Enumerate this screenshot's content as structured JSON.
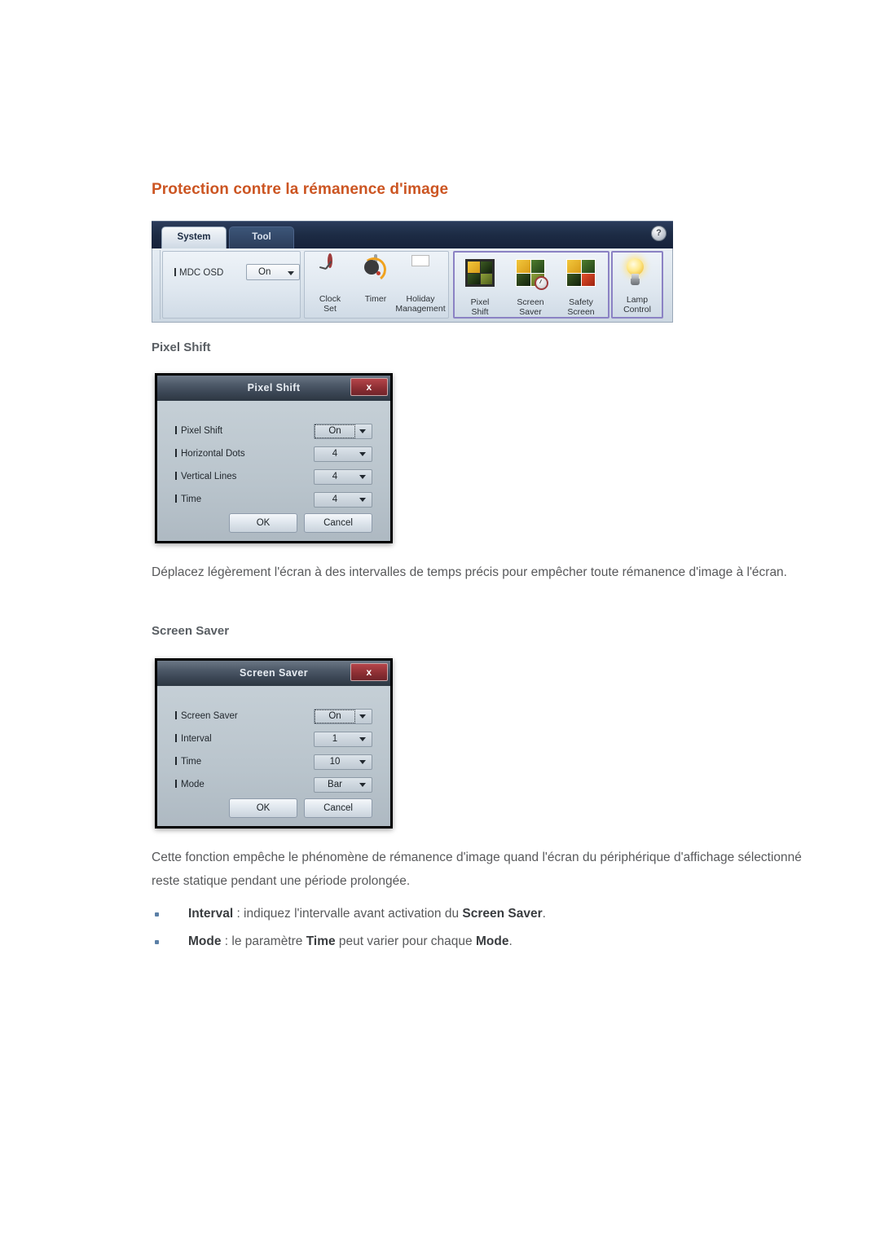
{
  "page": {
    "title": "Protection contre la rémanence d'image",
    "title_color": "#cc5522"
  },
  "ribbon": {
    "tabs": [
      {
        "label": "System",
        "active": true
      },
      {
        "label": "Tool",
        "active": false
      }
    ],
    "help_icon": "?",
    "osd": {
      "label": "MDC OSD",
      "value": "On"
    },
    "groups": [
      {
        "name": "time",
        "items": [
          {
            "line1": "Clock",
            "line2": "Set",
            "icon": "clock-icon"
          },
          {
            "line1": "Timer",
            "line2": "",
            "icon": "timer-icon"
          },
          {
            "line1": "Holiday",
            "line2": "Management",
            "icon": "calendar-icon"
          }
        ]
      },
      {
        "name": "protection",
        "highlighted": true,
        "items": [
          {
            "line1": "Pixel",
            "line2": "Shift",
            "icon": "pixel-shift-icon"
          },
          {
            "line1": "Screen",
            "line2": "Saver",
            "icon": "screen-saver-icon"
          },
          {
            "line1": "Safety",
            "line2": "Screen",
            "icon": "safety-screen-icon"
          }
        ]
      },
      {
        "name": "lamp",
        "highlighted": true,
        "items": [
          {
            "line1": "Lamp",
            "line2": "Control",
            "icon": "lamp-icon"
          }
        ]
      }
    ]
  },
  "sections": [
    {
      "heading": "Pixel Shift",
      "dialog": {
        "title": "Pixel Shift",
        "close_label": "x",
        "rows": [
          {
            "label": "Pixel Shift",
            "value": "On",
            "focused": true
          },
          {
            "label": "Horizontal Dots",
            "value": "4",
            "focused": false
          },
          {
            "label": "Vertical Lines",
            "value": "4",
            "focused": false
          },
          {
            "label": "Time",
            "value": "4",
            "focused": false
          }
        ],
        "ok_label": "OK",
        "cancel_label": "Cancel"
      },
      "paragraph": "Déplacez légèrement l'écran à des intervalles de temps précis pour empêcher toute rémanence d'image à l'écran."
    },
    {
      "heading": "Screen Saver",
      "dialog": {
        "title": "Screen Saver",
        "close_label": "x",
        "rows": [
          {
            "label": "Screen Saver",
            "value": "On",
            "focused": true
          },
          {
            "label": "Interval",
            "value": "1",
            "focused": false
          },
          {
            "label": "Time",
            "value": "10",
            "focused": false
          },
          {
            "label": "Mode",
            "value": "Bar",
            "focused": false
          }
        ],
        "ok_label": "OK",
        "cancel_label": "Cancel"
      },
      "paragraph": "Cette fonction empêche le phénomène de rémanence d'image quand l'écran du périphérique d'affichage sélectionné reste statique pendant une période prolongée."
    }
  ],
  "bullets": [
    {
      "parts": [
        {
          "text": "Interval",
          "bold": true
        },
        {
          "text": " : indiquez l'intervalle avant activation du ",
          "bold": false
        },
        {
          "text": "Screen Saver",
          "bold": true
        },
        {
          "text": ".",
          "bold": false
        }
      ]
    },
    {
      "parts": [
        {
          "text": "Mode",
          "bold": true
        },
        {
          "text": " : le paramètre ",
          "bold": false
        },
        {
          "text": "Time",
          "bold": true
        },
        {
          "text": " peut varier pour chaque ",
          "bold": false
        },
        {
          "text": "Mode",
          "bold": true
        },
        {
          "text": ".",
          "bold": false
        }
      ]
    }
  ]
}
